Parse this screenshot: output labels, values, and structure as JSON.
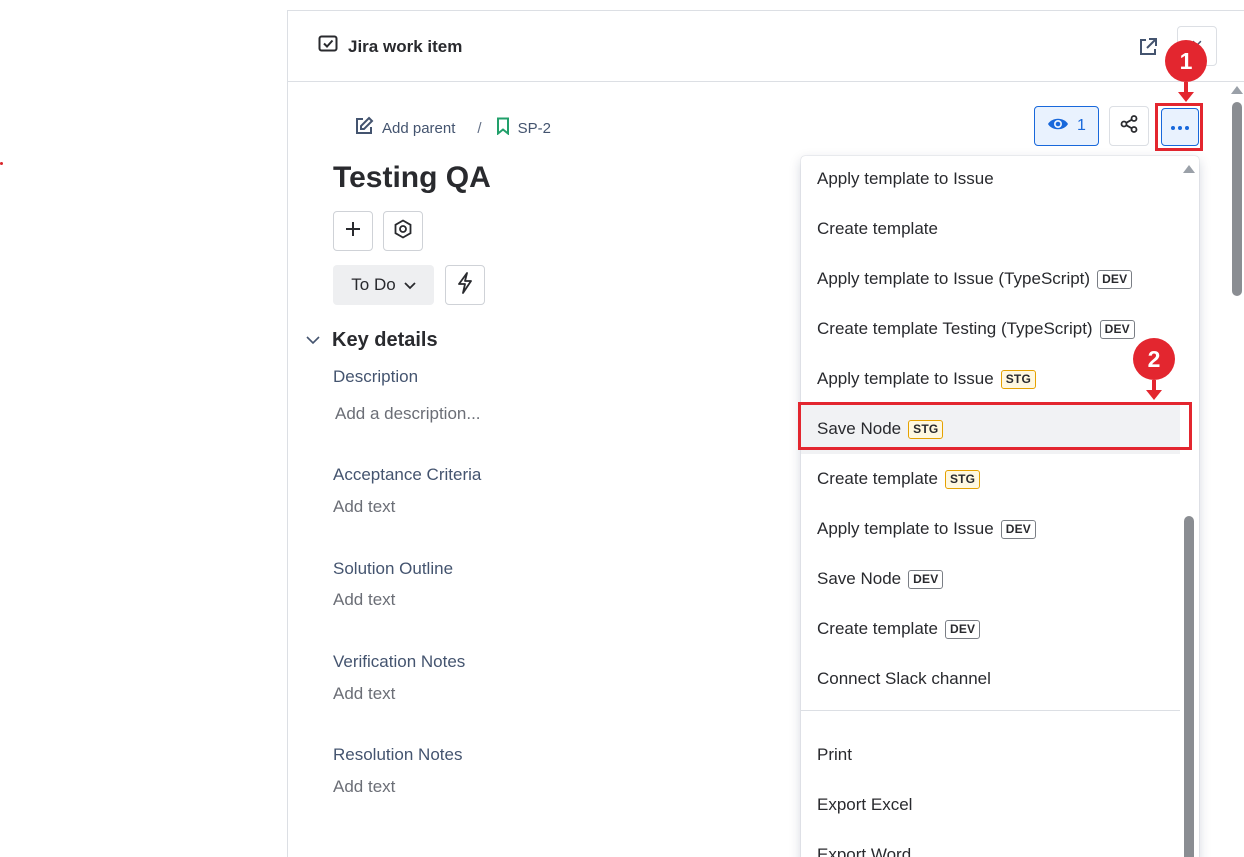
{
  "panel": {
    "title": "Jira work item",
    "close_label": "×"
  },
  "breadcrumb": {
    "add_parent": "Add parent",
    "separator": "/",
    "issue_key": "SP-2"
  },
  "actions": {
    "watch_count": "1"
  },
  "issue": {
    "title": "Testing QA",
    "status": "To Do"
  },
  "key_details": {
    "heading": "Key details",
    "fields": [
      {
        "label": "Description",
        "hint": "Add a description..."
      },
      {
        "label": "Acceptance Criteria",
        "hint": "Add text"
      },
      {
        "label": "Solution Outline",
        "hint": "Add text"
      },
      {
        "label": "Verification Notes",
        "hint": "Add text"
      },
      {
        "label": "Resolution Notes",
        "hint": "Add text"
      }
    ]
  },
  "menu": {
    "items": [
      {
        "label": "Apply template to Issue",
        "badge": ""
      },
      {
        "label": "Create template",
        "badge": ""
      },
      {
        "label": "Apply template to Issue (TypeScript)",
        "badge": "DEV"
      },
      {
        "label": "Create template Testing (TypeScript)",
        "badge": "DEV"
      },
      {
        "label": "Apply template to Issue",
        "badge": "STG"
      },
      {
        "label": "Save Node",
        "badge": "STG"
      },
      {
        "label": "Create template",
        "badge": "STG"
      },
      {
        "label": "Apply template to Issue",
        "badge": "DEV"
      },
      {
        "label": "Save Node",
        "badge": "DEV"
      },
      {
        "label": "Create template",
        "badge": "DEV"
      },
      {
        "label": "Connect Slack channel",
        "badge": ""
      },
      {
        "label": "Print",
        "badge": ""
      },
      {
        "label": "Export Excel",
        "badge": ""
      },
      {
        "label": "Export Word",
        "badge": ""
      }
    ]
  },
  "annotations": {
    "step1": "1",
    "step2": "2"
  },
  "colors": {
    "accent": "#1868db",
    "annotation_red": "#e3262f",
    "stg_badge": "#e5a100",
    "status_bg": "#eeeff1"
  },
  "icons": [
    "checkbox-icon",
    "external-link-icon",
    "close-icon",
    "edit-icon",
    "bookmark-icon",
    "eye-icon",
    "share-icon",
    "more-icon",
    "plus-icon",
    "settings-icon",
    "chevron-down-icon",
    "lightning-icon"
  ]
}
